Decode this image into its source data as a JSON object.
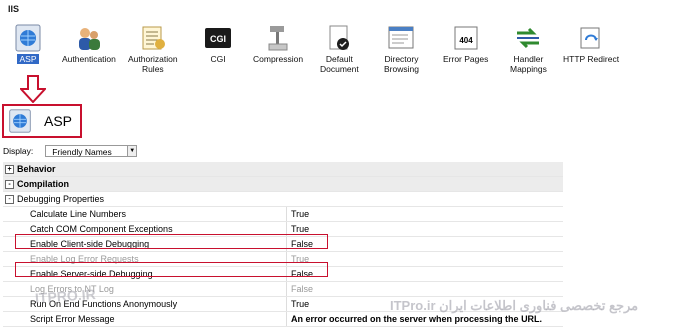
{
  "section_title": "IIS",
  "features": [
    {
      "label": "ASP",
      "icon": "asp-globe-icon",
      "selected": true
    },
    {
      "label": "Authentication",
      "icon": "authentication-users-icon"
    },
    {
      "label": "Authorization\nRules",
      "icon": "authorization-rules-icon"
    },
    {
      "label": "CGI",
      "icon": "cgi-icon"
    },
    {
      "label": "Compression",
      "icon": "compression-clamp-icon"
    },
    {
      "label": "Default\nDocument",
      "icon": "default-document-icon"
    },
    {
      "label": "Directory\nBrowsing",
      "icon": "directory-browsing-icon"
    },
    {
      "label": "Error Pages",
      "icon": "error-pages-404-icon"
    },
    {
      "label": "Handler\nMappings",
      "icon": "handler-mappings-icon"
    },
    {
      "label": "HTTP Redirect",
      "icon": "http-redirect-icon"
    }
  ],
  "page": {
    "title": "ASP",
    "icon": "asp-globe-icon"
  },
  "display": {
    "label": "Display:",
    "value": "Friendly Names"
  },
  "grid": {
    "rows": [
      {
        "kind": "cat",
        "box": "+",
        "name": "Behavior"
      },
      {
        "kind": "cat",
        "box": "-",
        "name": "Compilation"
      },
      {
        "kind": "sub",
        "box": "-",
        "name": "Debugging Properties"
      },
      {
        "kind": "prop",
        "name": "Calculate Line Numbers",
        "value": "True"
      },
      {
        "kind": "prop",
        "name": "Catch COM Component Exceptions",
        "value": "True"
      },
      {
        "kind": "prop",
        "name": "Enable Client-side Debugging",
        "value": "False",
        "highlight": true
      },
      {
        "kind": "prop",
        "name": "Enable Log Error Requests",
        "value": "True",
        "dim": true
      },
      {
        "kind": "prop",
        "name": "Enable Server-side Debugging",
        "value": "False",
        "highlight": true
      },
      {
        "kind": "prop",
        "name": "Log Errors to NT Log",
        "value": "False",
        "dim": true
      },
      {
        "kind": "prop",
        "name": "Run On End Functions Anonymously",
        "value": "True"
      },
      {
        "kind": "prop",
        "name": "Script Error Message",
        "value": "An error occurred on the server when processing the URL."
      }
    ]
  },
  "watermark": {
    "text1": "ITPRO.IR",
    "text2": "ITPro.ir مرجع تخصصی فناوری اطلاعات ایران"
  }
}
